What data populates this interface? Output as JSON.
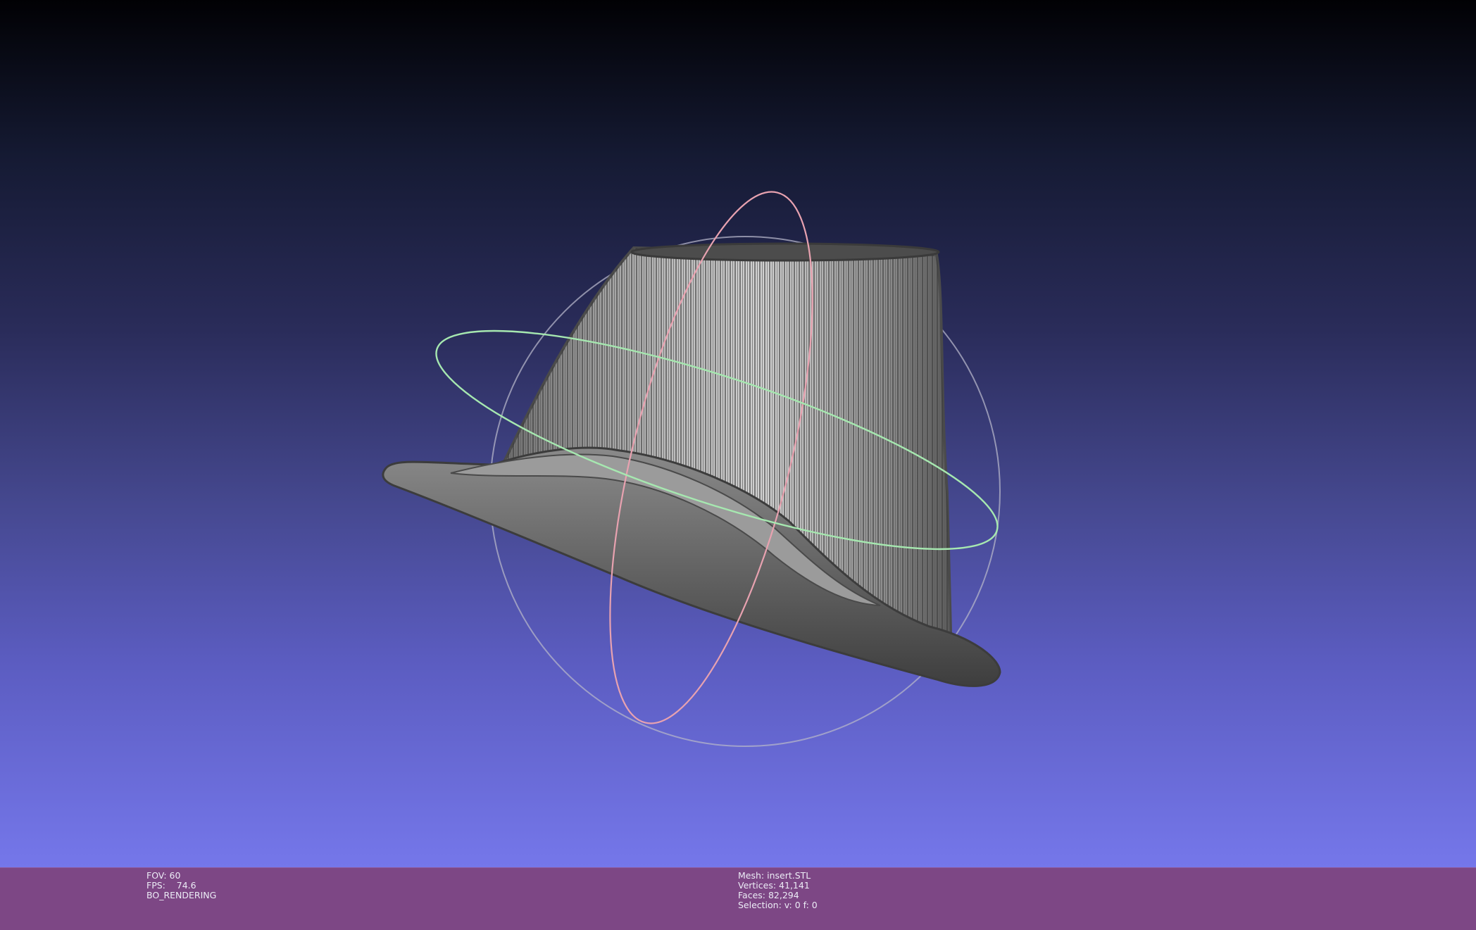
{
  "viewport": {
    "background_top": "#010104",
    "background_bottom": "#7577ea",
    "mesh_color": "#5a5a5a",
    "mesh_highlight": "#d8d8d8",
    "trackball_colors": {
      "x_ring": "#e8a2b0",
      "y_ring": "#a6e8b0",
      "z_ring": "#b4b4c8"
    }
  },
  "info_bar": {
    "background": "#7d4785",
    "fov": "FOV: 60",
    "fps": "FPS:    74.6",
    "render_mode": "BO_RENDERING",
    "mesh": "Mesh: insert.STL",
    "vertices": "Vertices: 41,141",
    "faces": "Faces: 82,294",
    "selection": "Selection: v: 0 f: 0"
  }
}
